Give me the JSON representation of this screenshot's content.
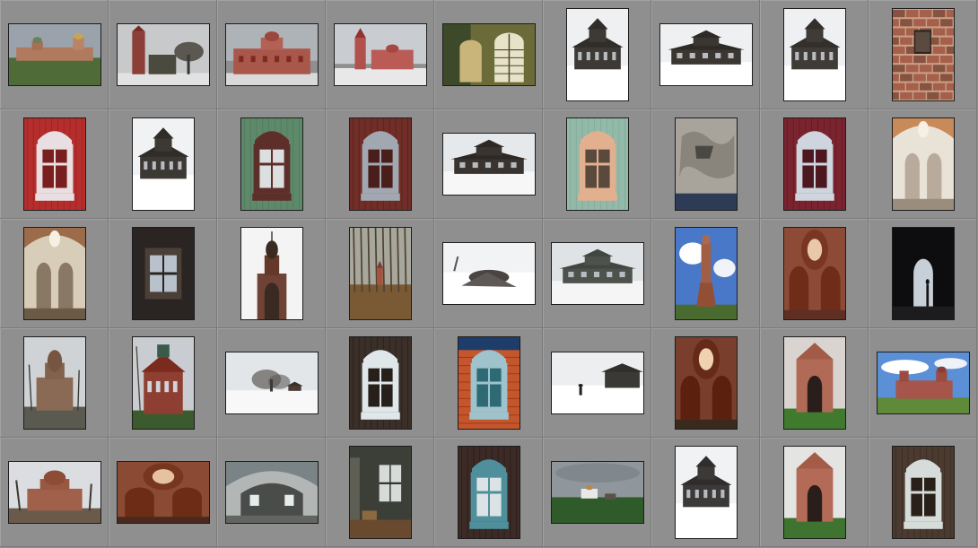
{
  "grid": {
    "background": "#8f8f8f",
    "rows": [
      {
        "cells": [
          {
            "orientation": "landscape",
            "scene": "church-ensemble",
            "colors": [
              "#9aa3ab",
              "#b07a5e",
              "#4f6b38"
            ]
          },
          {
            "orientation": "landscape",
            "scene": "bell-tower-trees",
            "colors": [
              "#c7c9cb",
              "#8b3f36",
              "#4a4a3e"
            ]
          },
          {
            "orientation": "landscape",
            "scene": "red-church",
            "colors": [
              "#aeb3b8",
              "#a9574b",
              "#d9d9d9"
            ]
          },
          {
            "orientation": "landscape",
            "scene": "church-snow",
            "colors": [
              "#c9cdd2",
              "#b0514c",
              "#e8e8e8"
            ]
          },
          {
            "orientation": "landscape",
            "scene": "arched-interior",
            "colors": [
              "#6b6b3a",
              "#3d4a2a",
              "#c9b47a"
            ]
          },
          {
            "orientation": "portrait",
            "scene": "wooden-house-snow",
            "colors": [
              "#eef0f2",
              "#3d3a36",
              "#ffffff"
            ]
          },
          {
            "orientation": "landscape",
            "scene": "wooden-house-snow",
            "colors": [
              "#eef0f2",
              "#3a3632",
              "#ffffff"
            ]
          },
          {
            "orientation": "portrait",
            "scene": "wooden-house-snow",
            "colors": [
              "#eef0f2",
              "#3f3b37",
              "#ffffff"
            ]
          },
          {
            "orientation": "portrait",
            "scene": "brick-wall",
            "colors": [
              "#c9a088",
              "#9a4a35",
              "#6f3a2a"
            ]
          }
        ]
      },
      {
        "cells": [
          {
            "orientation": "portrait",
            "scene": "carved-window",
            "colors": [
              "#b52e2e",
              "#e9dfe2",
              "#7a1f1f"
            ]
          },
          {
            "orientation": "portrait",
            "scene": "wooden-house-snow",
            "colors": [
              "#f1f2f3",
              "#3c3833",
              "#ffffff"
            ]
          },
          {
            "orientation": "portrait",
            "scene": "carved-window",
            "colors": [
              "#5e8a6b",
              "#5e2f2a",
              "#dcdfe0"
            ]
          },
          {
            "orientation": "portrait",
            "scene": "carved-window",
            "colors": [
              "#6f2f28",
              "#a2a8b2",
              "#4a1e1a"
            ]
          },
          {
            "orientation": "landscape",
            "scene": "wooden-house-snow",
            "colors": [
              "#e6e9ec",
              "#3a3430",
              "#f7f7f7"
            ]
          },
          {
            "orientation": "portrait",
            "scene": "carved-window",
            "colors": [
              "#93b9a9",
              "#e2b08f",
              "#5a4a3e"
            ]
          },
          {
            "orientation": "portrait",
            "scene": "peeling-wall",
            "colors": [
              "#a8a49b",
              "#6b665d",
              "#2e3b56"
            ]
          },
          {
            "orientation": "portrait",
            "scene": "carved-window",
            "colors": [
              "#7a2430",
              "#ced5de",
              "#4d1720"
            ]
          },
          {
            "orientation": "portrait",
            "scene": "church-interior",
            "colors": [
              "#e8e2d7",
              "#c98a5a",
              "#9b8d7e"
            ]
          }
        ]
      },
      {
        "cells": [
          {
            "orientation": "portrait",
            "scene": "church-interior",
            "colors": [
              "#d8cdb8",
              "#9b6b4a",
              "#6a5a46"
            ]
          },
          {
            "orientation": "portrait",
            "scene": "dark-window",
            "colors": [
              "#2a2522",
              "#b9c2cc",
              "#4a4038"
            ]
          },
          {
            "orientation": "portrait",
            "scene": "onion-dome-ruin",
            "colors": [
              "#f4f4f4",
              "#6e4235",
              "#3a2a22"
            ]
          },
          {
            "orientation": "portrait",
            "scene": "autumn-forest",
            "colors": [
              "#a8a79c",
              "#7a5a34",
              "#4d4133"
            ]
          },
          {
            "orientation": "landscape",
            "scene": "wreck-snow",
            "colors": [
              "#f2f3f4",
              "#4a4543",
              "#c7cbcf"
            ]
          },
          {
            "orientation": "landscape",
            "scene": "wooden-house-snow",
            "colors": [
              "#dfe3e6",
              "#4d524d",
              "#f5f5f5"
            ]
          },
          {
            "orientation": "portrait",
            "scene": "bell-tower-sky",
            "colors": [
              "#4a78c8",
              "#a05f45",
              "#4a6b2f"
            ]
          },
          {
            "orientation": "portrait",
            "scene": "dome-interior",
            "colors": [
              "#8d4a36",
              "#e8c8a8",
              "#5e2f22"
            ]
          },
          {
            "orientation": "portrait",
            "scene": "dark-arch",
            "colors": [
              "#0d0d0f",
              "#c7cfd8",
              "#1c1c1f"
            ]
          }
        ]
      },
      {
        "cells": [
          {
            "orientation": "portrait",
            "scene": "ruined-church",
            "colors": [
              "#cfd3d6",
              "#8a6a54",
              "#5a5a50"
            ]
          },
          {
            "orientation": "portrait",
            "scene": "manor-house",
            "colors": [
              "#c9ccd1",
              "#8f3f32",
              "#3b5a2e"
            ]
          },
          {
            "orientation": "landscape",
            "scene": "winter-trees",
            "colors": [
              "#e3e6e8",
              "#5c5a56",
              "#f8f8f8"
            ]
          },
          {
            "orientation": "portrait",
            "scene": "carved-window",
            "colors": [
              "#3a2f29",
              "#dfe7ea",
              "#261f1a"
            ]
          },
          {
            "orientation": "portrait",
            "scene": "carved-window-orange",
            "colors": [
              "#c4562e",
              "#9fc3cc",
              "#1e3d6b"
            ]
          },
          {
            "orientation": "landscape",
            "scene": "snow-village",
            "colors": [
              "#eceef0",
              "#3a3936",
              "#ffffff"
            ]
          },
          {
            "orientation": "portrait",
            "scene": "dome-interior",
            "colors": [
              "#7a3f2c",
              "#f0d2b0",
              "#3a2a1e"
            ]
          },
          {
            "orientation": "portrait",
            "scene": "ruined-arch-grass",
            "colors": [
              "#d9d4cf",
              "#b06a55",
              "#3f7a2e"
            ]
          },
          {
            "orientation": "landscape",
            "scene": "church-blue-sky",
            "colors": [
              "#5b8fd6",
              "#a5554a",
              "#5e8a3a"
            ]
          }
        ]
      },
      {
        "cells": [
          {
            "orientation": "landscape",
            "scene": "ruined-church",
            "colors": [
              "#dcdde0",
              "#a0604a",
              "#6a5a4a"
            ]
          },
          {
            "orientation": "landscape",
            "scene": "dome-interior",
            "colors": [
              "#8a4a34",
              "#e6c2a0",
              "#4a2a1e"
            ]
          },
          {
            "orientation": "landscape",
            "scene": "vaulted-interior",
            "colors": [
              "#7a8386",
              "#b2b6b4",
              "#4a4c4a"
            ]
          },
          {
            "orientation": "portrait",
            "scene": "room-window",
            "colors": [
              "#3c3f38",
              "#d6dbd8",
              "#6a4a2e"
            ]
          },
          {
            "orientation": "portrait",
            "scene": "carved-window",
            "colors": [
              "#3b2a26",
              "#4f8f9b",
              "#dce3e6"
            ]
          },
          {
            "orientation": "landscape",
            "scene": "meadow-church",
            "colors": [
              "#8f969c",
              "#2f5a2a",
              "#e8e8e8"
            ]
          },
          {
            "orientation": "portrait",
            "scene": "wooden-house-snow",
            "colors": [
              "#f0f2f4",
              "#3c3a38",
              "#ffffff"
            ]
          },
          {
            "orientation": "portrait",
            "scene": "ruined-arch-grass",
            "colors": [
              "#e4e4e2",
              "#b36b58",
              "#3f7430"
            ]
          },
          {
            "orientation": "portrait",
            "scene": "carved-window",
            "colors": [
              "#4a3a30",
              "#d5dcd9",
              "#2a201a"
            ]
          }
        ]
      }
    ]
  }
}
